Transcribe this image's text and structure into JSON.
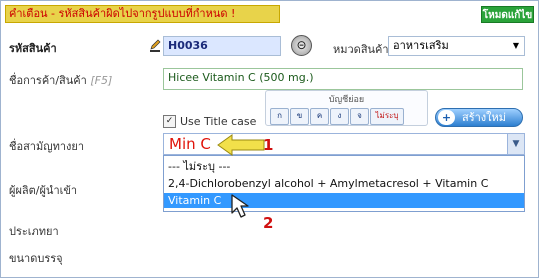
{
  "header": {
    "warning": "คำเตือน - รหัสสินค้าผิดไปจากรูปแบบที่กำหนด !",
    "mode": "โหมดแก้ไข"
  },
  "form": {
    "product_code_label": "รหัสสินค้า",
    "product_code": "H0036",
    "category_label": "หมวดสินค้า",
    "category": "อาหารเสริม",
    "product_name_label": "ชื่อการค้า/สินค้า",
    "product_name_hint": "[F5]",
    "product_name": "Hicee Vitamin C (500 mg.)",
    "use_title_case": "Use Title case",
    "subindex_title": "บัญชีย่อย",
    "subindex_buttons": [
      "ก",
      "ข",
      "ค",
      "ง",
      "จ",
      "ไม่ระบุ"
    ],
    "create_new": "สร้างใหม่",
    "generic_label": "ชื่อสามัญทางยา",
    "generic_value": "Min C",
    "manufacturer_label": "ผู้ผลิต/ผู้นำเข้า",
    "drug_type_label": "ประเภทยา",
    "package_size_label": "ขนาดบรรจุ"
  },
  "dropdown": {
    "options": [
      "--- ไม่ระบุ ---",
      "2,4-Dichlorobenzyl alcohol + Amylmetacresol + Vitamin C",
      "Vitamin C"
    ],
    "selected_index": 2
  },
  "annotations": {
    "step1": "1",
    "step2": "2"
  },
  "colors": {
    "warning_bg": "#e8d34a",
    "mode_bg": "#2aa33a",
    "selected_bg": "#3399ff",
    "annotation_red": "#d01010",
    "arrow_yellow": "#f2e04a"
  }
}
